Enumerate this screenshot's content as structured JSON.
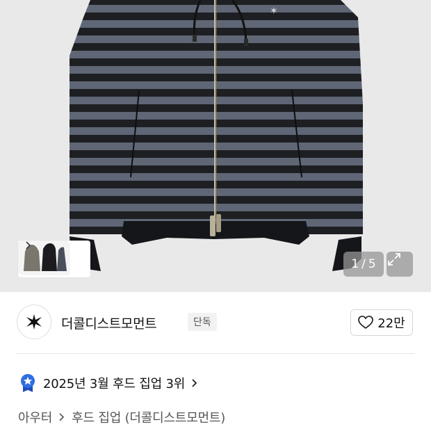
{
  "gallery": {
    "current": "1",
    "separator": "/",
    "total": "5",
    "expand_icon": "expand-icon",
    "thumbnail_next_icon": "chevron-right-icon"
  },
  "brand": {
    "name": "더콜디스트모먼트",
    "badge": "단독",
    "logo_icon": "star-logo-icon"
  },
  "like": {
    "icon": "heart-icon",
    "count": "22만"
  },
  "ranking": {
    "icon": "star-medal-icon",
    "text": "2025년 3월 후드 집업 3위"
  },
  "breadcrumb": {
    "category": "아우터",
    "subcategory": "후드 집업 (더콜디스트모먼트)"
  },
  "colors": {
    "stripe_dark": "#1e1f22",
    "stripe_blue": "#5f6676",
    "rank_badge": "#2f6fe0",
    "background": "#e9e9e9"
  }
}
